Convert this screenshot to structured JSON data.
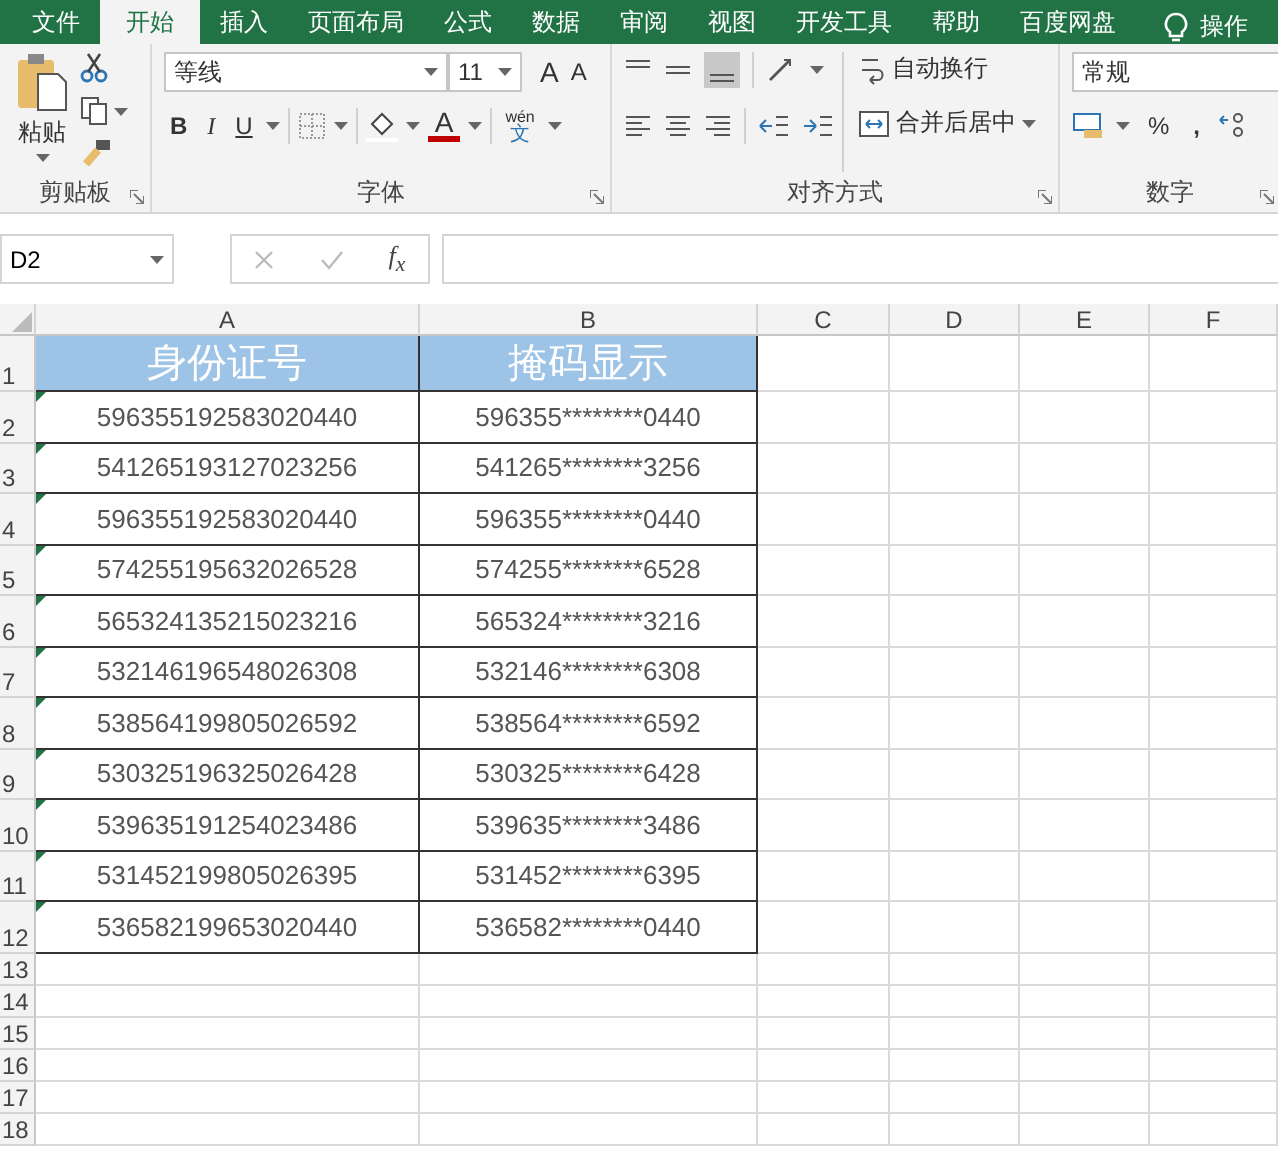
{
  "tabs": [
    {
      "label": "文件",
      "selected": false
    },
    {
      "label": "开始",
      "selected": true
    },
    {
      "label": "插入",
      "selected": false
    },
    {
      "label": "页面布局",
      "selected": false
    },
    {
      "label": "公式",
      "selected": false
    },
    {
      "label": "数据",
      "selected": false
    },
    {
      "label": "审阅",
      "selected": false
    },
    {
      "label": "视图",
      "selected": false
    },
    {
      "label": "开发工具",
      "selected": false
    },
    {
      "label": "帮助",
      "selected": false
    },
    {
      "label": "百度网盘",
      "selected": false
    }
  ],
  "tell_me": "操作",
  "ribbon": {
    "clipboard": {
      "paste": "粘贴",
      "label": "剪贴板"
    },
    "font": {
      "font_name": "等线",
      "font_size": "11",
      "grow": "A",
      "shrink": "A",
      "bold": "B",
      "italic": "I",
      "underline": "U",
      "font_color": "A",
      "phonetic_top": "wén",
      "phonetic_bottom": "文",
      "label": "字体"
    },
    "alignment": {
      "wrap": "自动换行",
      "merge": "合并后居中",
      "label": "对齐方式"
    },
    "number": {
      "format": "常规",
      "percent": "%",
      "comma": ",",
      "label": "数字"
    }
  },
  "formula_bar": {
    "name_box": "D2",
    "function_label": "f$_{x}$"
  },
  "sheet": {
    "columns": [
      "A",
      "B",
      "C",
      "D",
      "E",
      "F"
    ],
    "header": {
      "row": "1",
      "cells": [
        "身份证号",
        "掩码显示"
      ]
    },
    "rows": [
      {
        "row": "2",
        "flagged": true,
        "cells": [
          "596355192583020440",
          "596355********0440"
        ]
      },
      {
        "row": "3",
        "flagged": true,
        "cells": [
          "541265193127023256",
          "541265********3256"
        ]
      },
      {
        "row": "4",
        "flagged": true,
        "cells": [
          "596355192583020440",
          "596355********0440"
        ]
      },
      {
        "row": "5",
        "flagged": true,
        "cells": [
          "574255195632026528",
          "574255********6528"
        ]
      },
      {
        "row": "6",
        "flagged": true,
        "cells": [
          "565324135215023216",
          "565324********3216"
        ]
      },
      {
        "row": "7",
        "flagged": true,
        "cells": [
          "532146196548026308",
          "532146********6308"
        ]
      },
      {
        "row": "8",
        "flagged": true,
        "cells": [
          "538564199805026592",
          "538564********6592"
        ]
      },
      {
        "row": "9",
        "flagged": true,
        "cells": [
          "530325196325026428",
          "530325********6428"
        ]
      },
      {
        "row": "10",
        "flagged": true,
        "cells": [
          "539635191254023486",
          "539635********3486"
        ]
      },
      {
        "row": "11",
        "flagged": true,
        "cells": [
          "531452199805026395",
          "531452********6395"
        ]
      },
      {
        "row": "12",
        "flagged": true,
        "cells": [
          "536582199653020440",
          "536582********0440"
        ]
      }
    ],
    "empty_rows": [
      "13",
      "14",
      "15",
      "16",
      "17",
      "18"
    ]
  }
}
